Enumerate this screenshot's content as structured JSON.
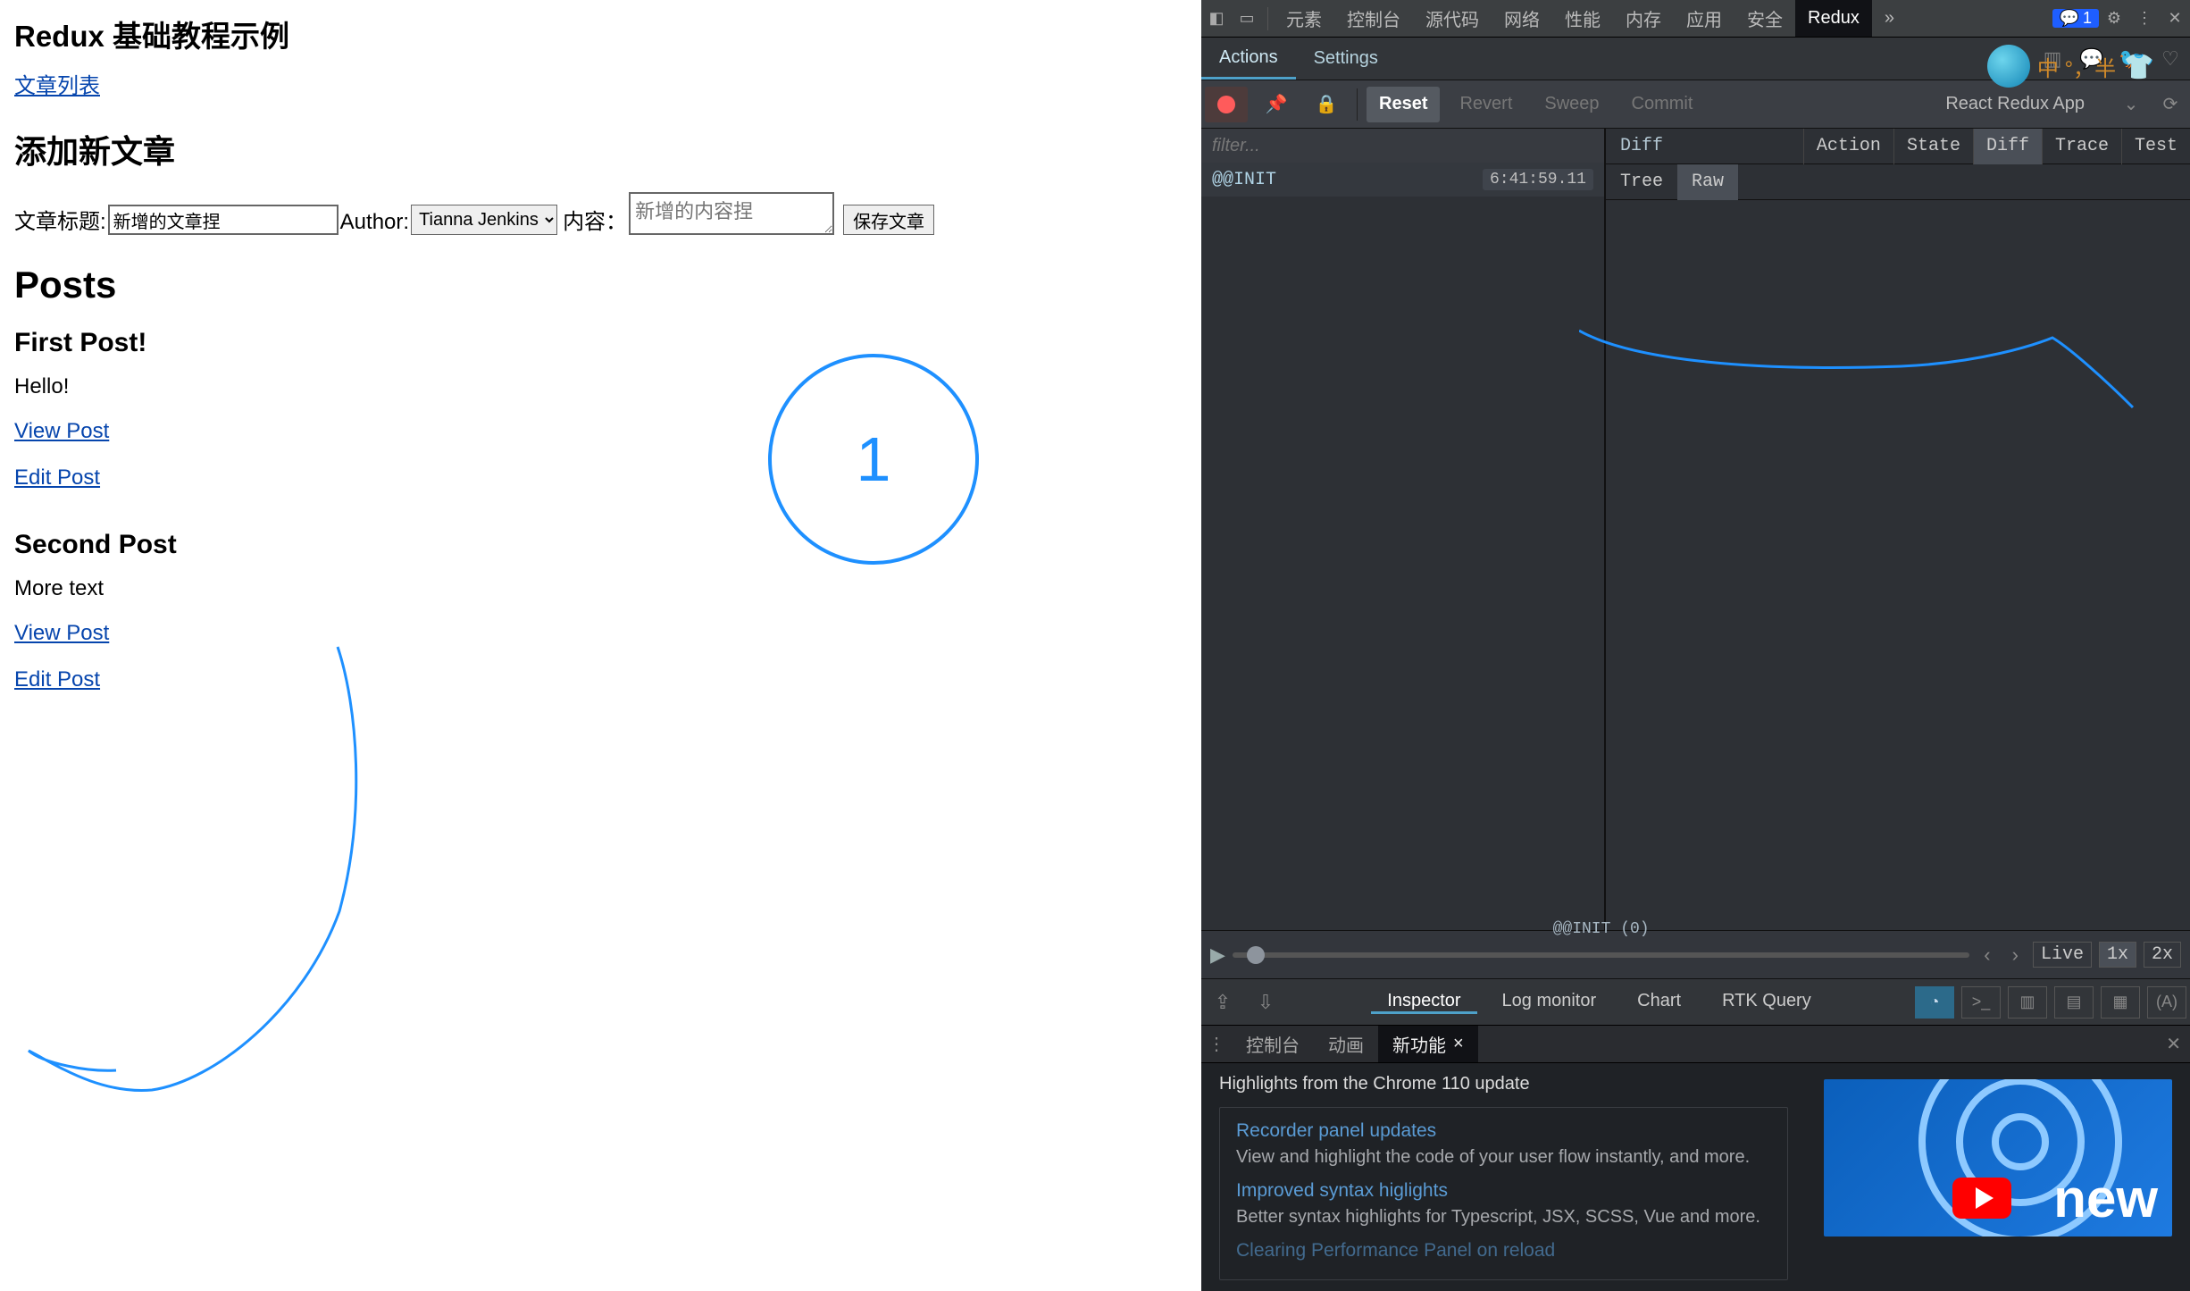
{
  "app": {
    "title": "Redux 基础教程示例",
    "navPosts": "文章列表",
    "addTitle": "添加新文章",
    "form": {
      "titleLabel": "文章标题:",
      "titleValue": "新增的文章捏",
      "authorLabel": "Author:",
      "authorSelected": "Tianna Jenkins",
      "contentLabel": "内容：",
      "contentPlaceholder": "新增的内容捏",
      "saveLabel": "保存文章"
    },
    "postsHeading": "Posts",
    "posts": [
      {
        "title": "First Post!",
        "excerpt": "Hello!",
        "viewLabel": "View Post",
        "editLabel": "Edit Post"
      },
      {
        "title": "Second Post",
        "excerpt": "More text",
        "viewLabel": "View Post",
        "editLabel": "Edit Post"
      }
    ],
    "annotationNumber": "1"
  },
  "devtools": {
    "topTabs": [
      "元素",
      "控制台",
      "源代码",
      "网络",
      "性能",
      "内存",
      "应用",
      "安全",
      "Redux"
    ],
    "topMore": "»",
    "errBadge": "1",
    "row2": {
      "actions": "Actions",
      "settings": "Settings"
    },
    "row3": {
      "reset": "Reset",
      "revert": "Revert",
      "sweep": "Sweep",
      "commit": "Commit",
      "appName": "React Redux App"
    },
    "filterPlaceholder": "filter...",
    "actions": [
      {
        "name": "@@INIT",
        "time": "6:41:59.11"
      }
    ],
    "diff": {
      "heading": "Diff",
      "tabs": [
        "Action",
        "State",
        "Diff",
        "Trace",
        "Test"
      ],
      "active": "Diff",
      "treeTabs": [
        "Tree",
        "Raw"
      ],
      "treeActive": "Raw"
    },
    "slider": {
      "label": "@@INIT (0)",
      "live": "Live",
      "x1": "1x",
      "x2": "2x"
    },
    "monitor": {
      "tabs": [
        "Inspector",
        "Log monitor",
        "Chart",
        "RTK Query"
      ],
      "active": "Inspector"
    },
    "drawer": {
      "tabs": [
        "控制台",
        "动画",
        "新功能"
      ],
      "active": "新功能",
      "headline": "Highlights from the Chrome 110 update",
      "cards": [
        {
          "title": "Recorder panel updates",
          "desc": "View and highlight the code of your user flow instantly, and more."
        },
        {
          "title": "Improved syntax higlights",
          "desc": "Better syntax highlights for Typescript, JSX, SCSS, Vue and more."
        },
        {
          "title": "Clearing Performance Panel on reload",
          "desc": ""
        }
      ],
      "thumbText": "new"
    },
    "overlay": {
      "text": "中 °，半"
    }
  }
}
